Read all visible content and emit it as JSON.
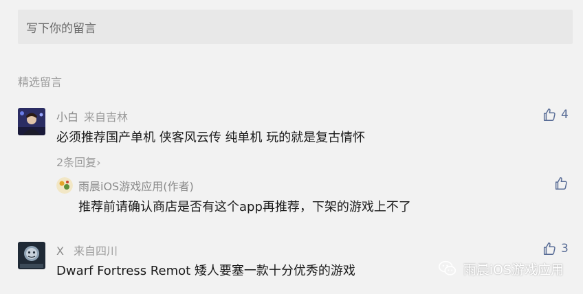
{
  "comment_input": {
    "placeholder": "写下你的留言"
  },
  "section_title": "精选留言",
  "comments": [
    {
      "name": "小白",
      "location": "来自吉林",
      "text": "必须推荐国产单机 侠客风云传 纯单机 玩的就是复古情怀",
      "likes": "4",
      "replies_label": "2条回复",
      "reply": {
        "name": "雨晨iOS游戏应用(作者)",
        "text": "推荐前请确认商店是否有这个app再推荐，下架的游戏上不了"
      }
    },
    {
      "name": "X",
      "location": "来自四川",
      "text": "Dwarf Fortress Remot  矮人要塞一款十分优秀的游戏",
      "likes": "3"
    }
  ],
  "watermark": "雨晨iOS游戏应用",
  "colors": {
    "link": "#576b95",
    "meta": "#8a8a8a",
    "background": "#f2f2f2"
  }
}
